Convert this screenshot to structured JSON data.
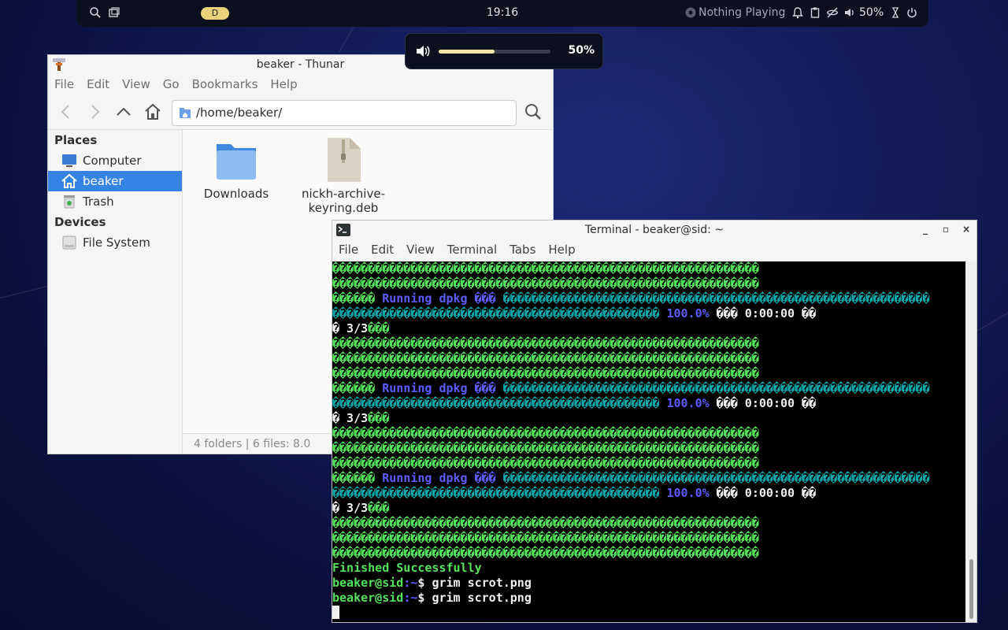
{
  "topbar": {
    "workspace": "D",
    "clock": "19:16",
    "media": "Nothing Playing",
    "volume": "50%"
  },
  "volume_osd": {
    "percent_label": "50%",
    "level": 0.5
  },
  "thunar": {
    "title": "beaker - Thunar",
    "menu": [
      "File",
      "Edit",
      "View",
      "Go",
      "Bookmarks",
      "Help"
    ],
    "path": "/home/beaker/",
    "places_header": "Places",
    "places": [
      "Computer",
      "beaker",
      "Trash"
    ],
    "devices_header": "Devices",
    "devices": [
      "File System"
    ],
    "files": [
      {
        "name": "Downloads",
        "type": "folder"
      },
      {
        "name1": "nickh-archive-",
        "name2": "keyring.deb",
        "type": "archive"
      }
    ],
    "status": "4 folders  |  6 files: 8.0 "
  },
  "terminal": {
    "title": "Terminal - beaker@sid: ~",
    "menu": [
      "File",
      "Edit",
      "View",
      "Terminal",
      "Tabs",
      "Help"
    ],
    "garble": "������������������������������������������������������������",
    "running": " Running dpkg ",
    "progress": "100.0%",
    "time": "0:00:00",
    "count": " 3/3",
    "finished": "Finished Successfully",
    "prompt_user": "beaker@sid",
    "prompt_path": ":~",
    "prompt_sym": "$ ",
    "command": "grim scrot.png"
  }
}
